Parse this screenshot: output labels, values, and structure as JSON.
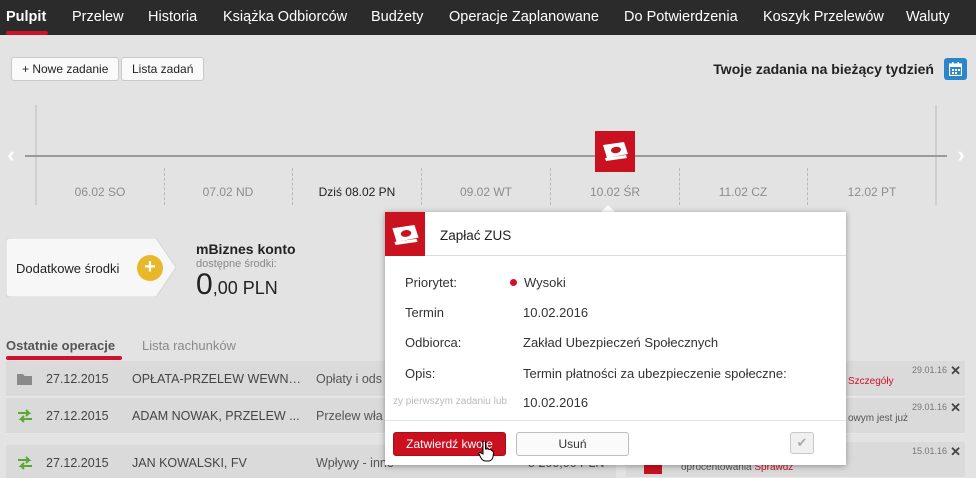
{
  "nav": {
    "items": [
      "Pulpit",
      "Przelew",
      "Historia",
      "Książka Odbiorców",
      "Budżety",
      "Operacje Zaplanowane",
      "Do Potwierdzenia",
      "Koszyk Przelewów",
      "Waluty"
    ],
    "active_index": 0
  },
  "toolbar": {
    "new_task": "+ Nowe zadanie",
    "task_list": "Lista zadań",
    "week_title": "Twoje zadania na bieżący tydzień"
  },
  "timeline": {
    "days": [
      "06.02 SO",
      "07.02 ND",
      "Dziś 08.02 PN",
      "09.02 WT",
      "10.02 ŚR",
      "11.02 CZ",
      "12.02 PT"
    ],
    "today_index": 2,
    "marker_day_index": 4
  },
  "funds": {
    "button_label": "Dodatkowe środki",
    "account_name": "mBiznes konto",
    "available_label": "dostępne środki:",
    "balance_int": "0",
    "balance_dec": ",00 PLN"
  },
  "tabs": {
    "recent": "Ostatnie operacje",
    "accounts": "Lista rachunków"
  },
  "operations": [
    {
      "icon": "folder-icon",
      "date": "27.12.2015",
      "title": "OPŁATA-PRZELEW WEWN....",
      "desc": "Opłaty i ods",
      "amount": ""
    },
    {
      "icon": "transfer-arrows-icon",
      "date": "27.12.2015",
      "title": "ADAM NOWAK, PRZELEW ...",
      "desc": "Przelew wła",
      "amount": ""
    },
    {
      "icon": "transfer-arrows-icon",
      "date": "27.12.2015",
      "title": "JAN KOWALSKI, FV",
      "desc": "Wpływy - inne",
      "amount": "5 200,00 PLN"
    }
  ],
  "notifications": [
    {
      "date": "29.01.16",
      "text": "",
      "link": "Szczegóły"
    },
    {
      "date": "29.01.16",
      "text": "owym jest już",
      "link": ""
    },
    {
      "date": "15.01.16",
      "text": "oprocentowania ",
      "link": "Sprawdź"
    }
  ],
  "popup": {
    "title": "Zapłać ZUS",
    "fields": [
      {
        "label": "Priorytet:",
        "value": "Wysoki"
      },
      {
        "label": "Termin",
        "value": "10.02.2016"
      },
      {
        "label": "Odbiorca:",
        "value": "Zakład Ubezpieczeń Społecznych"
      },
      {
        "label": "Opis:",
        "value": "Termin płatności za ubezpieczenie społeczne:"
      }
    ],
    "desc_line2": "10.02.2016",
    "tooltip_ghost": "zy pierwszym zadaniu lub",
    "confirm_label": "Zatwierdź kwotę",
    "delete_label": "Usuń"
  },
  "colors": {
    "brand_red": "#c9111f",
    "nav_bg": "#2b2b2b",
    "accent_yellow": "#e9b82a",
    "calendar_blue": "#2a86c8"
  }
}
